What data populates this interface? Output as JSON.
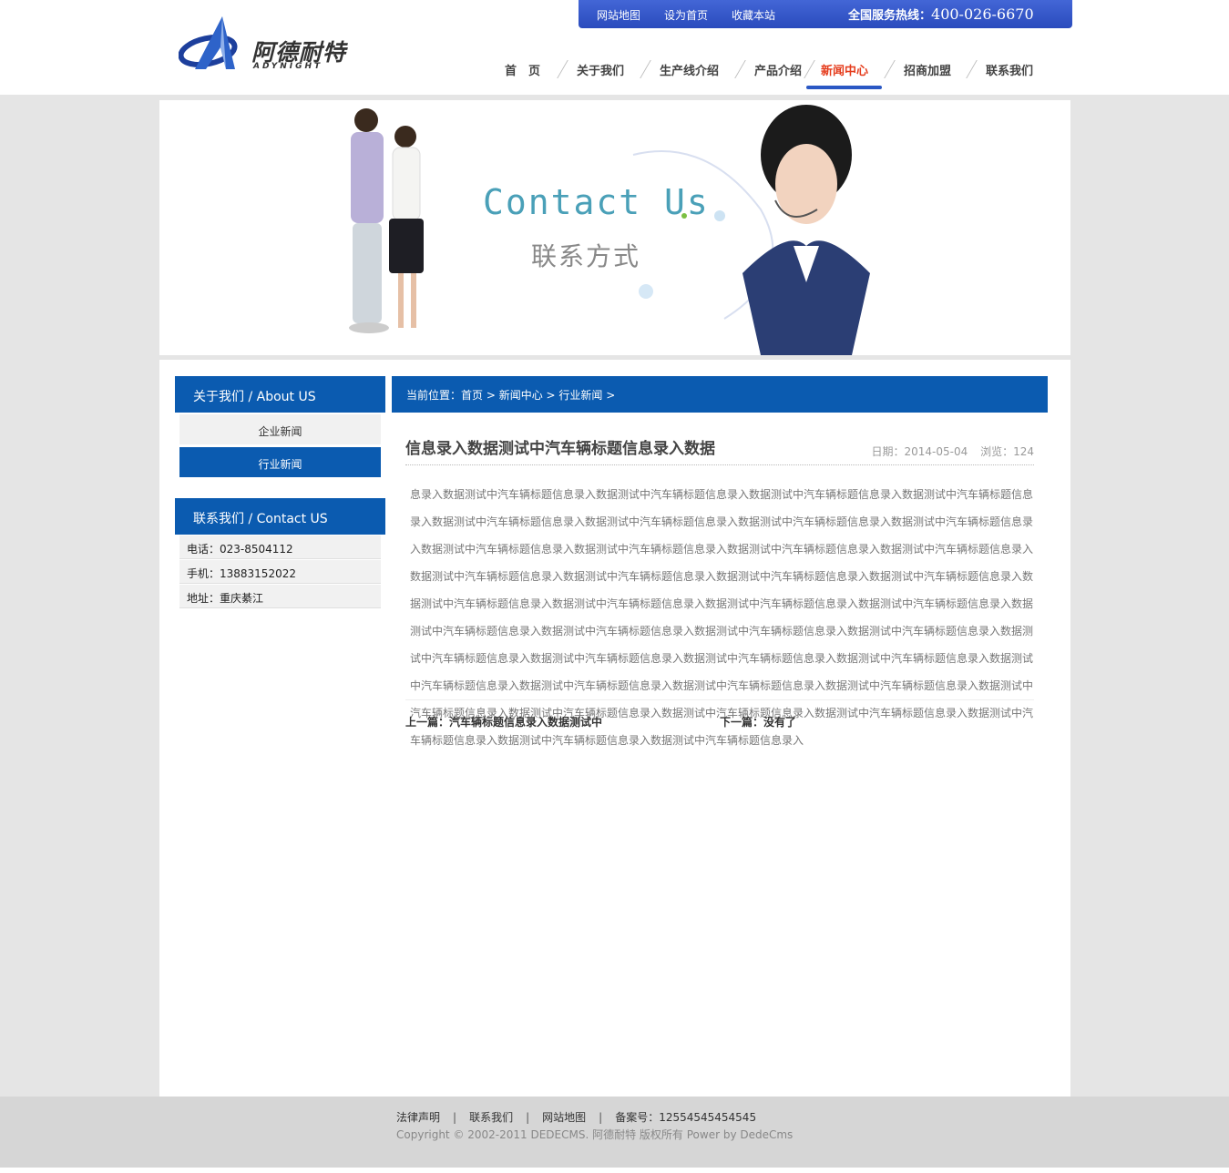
{
  "logo": {
    "brand": "阿德耐特",
    "brand_en": "ADYNIGHT"
  },
  "topbar": {
    "links": [
      "网站地图",
      "设为首页",
      "收藏本站"
    ],
    "hotline_label": "全国服务热线：",
    "hotline_number": "400-026-6670"
  },
  "nav": {
    "items": [
      "首　页",
      "关于我们",
      "生产线介绍",
      "产品介绍",
      "新闻中心",
      "招商加盟",
      "联系我们"
    ],
    "active": "新闻中心"
  },
  "banner": {
    "title_en": "Contact Us",
    "title_cn": "联系方式"
  },
  "sidebar": {
    "about_head": "关于我们 / About US",
    "categories": [
      "企业新闻",
      "行业新闻"
    ],
    "active_category": "行业新闻",
    "contact_head": "联系我们 / Contact US",
    "contacts": [
      "电话：023-8504112",
      "手机：13883152022",
      "地址：重庆綦江"
    ]
  },
  "breadcrumb": {
    "label": "当前位置：",
    "items": [
      "首页",
      "新闻中心",
      "行业新闻"
    ],
    "sep": " > "
  },
  "article": {
    "title": "信息录入数据测试中汽车辆标题信息录入数据",
    "date": "日期：2014-05-04",
    "views": "浏览：124",
    "body": "息录入数据测试中汽车辆标题信息录入数据测试中汽车辆标题信息录入数据测试中汽车辆标题信息录入数据测试中汽车辆标题信息录入数据测试中汽车辆标题信息录入数据测试中汽车辆标题信息录入数据测试中汽车辆标题信息录入数据测试中汽车辆标题信息录入数据测试中汽车辆标题信息录入数据测试中汽车辆标题信息录入数据测试中汽车辆标题信息录入数据测试中汽车辆标题信息录入数据测试中汽车辆标题信息录入数据测试中汽车辆标题信息录入数据测试中汽车辆标题信息录入数据测试中汽车辆标题信息录入数据测试中汽车辆标题信息录入数据测试中汽车辆标题信息录入数据测试中汽车辆标题信息录入数据测试中汽车辆标题信息录入数据测试中汽车辆标题信息录入数据测试中汽车辆标题信息录入数据测试中汽车辆标题信息录入数据测试中汽车辆标题信息录入数据测试中汽车辆标题信息录入数据测试中汽车辆标题信息录入数据测试中汽车辆标题信息录入数据测试中汽车辆标题信息录入数据测试中汽车辆标题信息录入数据测试中汽车辆标题信息录入数据测试中汽车辆标题信息录入数据测试中汽车辆标题信息录入数据测试中汽车辆标题信息录入数据测试中汽车辆标题信息录入数据测试中汽车辆标题信息录入数据测试中汽车辆标题信息录入数据测试中汽车辆标题信息录入数据测试中汽车辆标题信息录入数据测试中汽车辆标题信息录入",
    "prev": "上一篇：汽车辆标题信息录入数据测试中",
    "next": "下一篇：没有了"
  },
  "footer": {
    "links": [
      "法律声明",
      "联系我们",
      "网站地图",
      "备案号：12554545454545"
    ],
    "copyright": "Copyright © 2002-2011 DEDECMS. 阿德耐特 版权所有 Power by DedeCms"
  },
  "colors": {
    "brand_blue": "#0b5bb0",
    "nav_active": "#e53c1c",
    "topbar": "#3558cc"
  }
}
